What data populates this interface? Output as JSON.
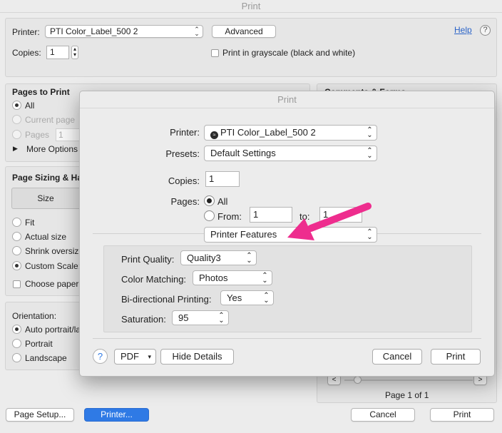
{
  "window": {
    "title": "Print"
  },
  "top": {
    "printer_label": "Printer:",
    "printer_value": "PTI Color_Label_500 2",
    "advanced_button": "Advanced",
    "help_link": "Help",
    "copies_label": "Copies:",
    "copies_value": "1",
    "grayscale_label": "Print in grayscale (black and white)"
  },
  "pages_to_print": {
    "title": "Pages to Print",
    "all": "All",
    "current_page": "Current page",
    "pages": "Pages",
    "pages_value": "1",
    "more_options": "More Options"
  },
  "comments_forms": {
    "title": "Comments & Forms"
  },
  "sizing": {
    "title": "Page Sizing & Ha",
    "size_button": "Size",
    "fit": "Fit",
    "actual_size": "Actual size",
    "shrink": "Shrink oversize",
    "custom_scale": "Custom Scale:",
    "choose_paper": "Choose paper"
  },
  "orientation": {
    "title": "Orientation:",
    "auto": "Auto portrait/la",
    "portrait": "Portrait",
    "landscape": "Landscape"
  },
  "preview": {
    "prev": "<",
    "next": ">",
    "page_indicator": "Page 1 of 1"
  },
  "bottom_bar": {
    "page_setup": "Page Setup...",
    "printer": "Printer...",
    "cancel": "Cancel",
    "print": "Print"
  },
  "dialog": {
    "title": "Print",
    "printer_label": "Printer:",
    "printer_value": "PTI Color_Label_500 2",
    "presets_label": "Presets:",
    "presets_value": "Default Settings",
    "copies_label": "Copies:",
    "copies_value": "1",
    "pages_label": "Pages:",
    "pages_all": "All",
    "pages_from": "From:",
    "from_value": "1",
    "to_label": "to:",
    "to_value": "1",
    "section_value": "Printer Features",
    "features": [
      {
        "label": "Print Quality:",
        "value": "Quality3"
      },
      {
        "label": "Color Matching:",
        "value": "Photos"
      },
      {
        "label": "Bi-directional Printing:",
        "value": "Yes"
      },
      {
        "label": "Saturation:",
        "value": "95"
      }
    ],
    "help": "?",
    "pdf": "PDF",
    "hide_details": "Hide Details",
    "cancel": "Cancel",
    "print": "Print"
  },
  "colors": {
    "accent": "#2f7ae5",
    "arrow": "#ee2d8e",
    "link": "#2a63c8"
  },
  "icons": [
    "help-icon",
    "chevron-updown-icon",
    "disclosure-triangle-icon",
    "printer-status-icon",
    "arrow-annotation"
  ]
}
